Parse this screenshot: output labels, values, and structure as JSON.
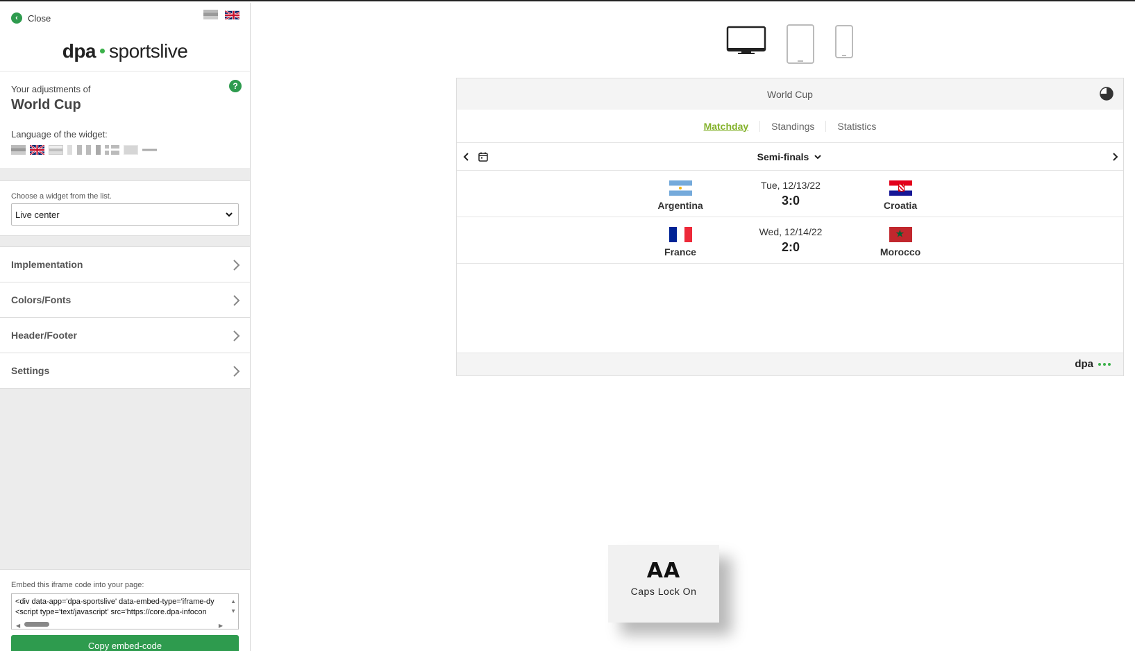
{
  "sidebar": {
    "close_label": "Close",
    "logo_left": "dpa",
    "logo_right": "sportslive",
    "adjust_sub": "Your adjustments of",
    "adjust_title": "World Cup",
    "help_symbol": "?",
    "language_label": "Language of the widget:",
    "widget_label": "Choose a widget from the list.",
    "widget_value": "Live center",
    "menu": [
      "Implementation",
      "Colors/Fonts",
      "Header/Footer",
      "Settings"
    ],
    "embed_label": "Embed this iframe code into your page:",
    "embed_line1": "<div data-app='dpa-sportslive' data-embed-type='iframe-dy",
    "embed_line2": "<script type='text/javascript' src='https://core.dpa-infocon",
    "copy_label": "Copy embed-code"
  },
  "devices": [
    "desktop-icon",
    "tablet-icon",
    "phone-icon"
  ],
  "widget": {
    "title": "World Cup",
    "tabs": [
      "Matchday",
      "Standings",
      "Statistics"
    ],
    "active_tab": "Matchday",
    "round": "Semi-finals",
    "matches": [
      {
        "home": "Argentina",
        "away": "Croatia",
        "date": "Tue, 12/13/22",
        "score": "3:0"
      },
      {
        "home": "France",
        "away": "Morocco",
        "date": "Wed, 12/14/22",
        "score": "2:0"
      }
    ],
    "footer_logo": "dpa"
  },
  "caps_lock": {
    "icon": "AA",
    "label": "Caps Lock On"
  },
  "colors": {
    "accent_green": "#2e9b4e",
    "tab_active": "#84b22c"
  }
}
